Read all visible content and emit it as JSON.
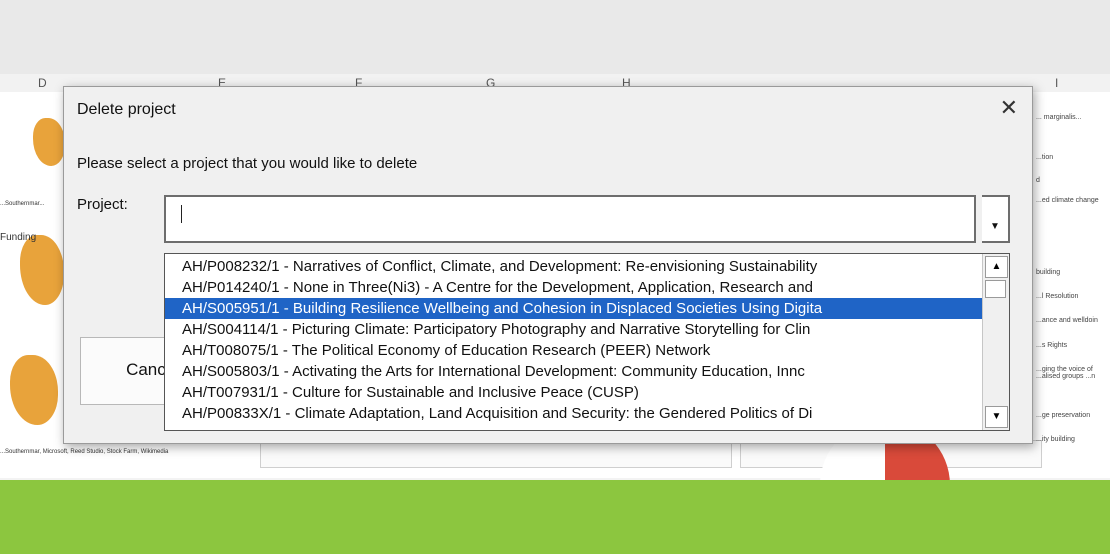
{
  "spreadsheet": {
    "columns": [
      "D",
      "E",
      "F",
      "G",
      "H",
      "I"
    ],
    "left_labels": [
      "Funding",
      "...Southernmar...",
      "...Southernmar, Microsoft, Reed Studio, Stock Farm, Wikimedia"
    ],
    "right_labels": [
      "... marginalis...",
      "...tion",
      "d",
      "...ed climate change",
      "building",
      "...l Resolution",
      "...ance and welldoin",
      "...s Rights",
      "...ging the voice of ...alised groups ...n",
      "...ge preservation",
      "...ity building"
    ]
  },
  "dialog": {
    "title": "Delete project",
    "prompt": "Please select a project that you would like to delete",
    "project_label": "Project:",
    "input_value": "",
    "cancel_label": "Cancel",
    "list_items": [
      "AH/P008232/1 - Narratives of Conflict, Climate, and Development: Re-envisioning Sustainability",
      "AH/P014240/1 - None in Three(Ni3) - A Centre for the Development, Application, Research and",
      "AH/S005951/1 - Building Resilience Wellbeing and Cohesion in Displaced Societies Using Digita",
      "AH/S004114/1 - Picturing Climate: Participatory Photography and Narrative Storytelling for Clin",
      "AH/T008075/1 - The Political Economy of Education Research (PEER) Network",
      "AH/S005803/1 - Activating the Arts for International Development: Community Education, Innc",
      "AH/T007931/1 - Culture for Sustainable and Inclusive Peace (CUSP)",
      "AH/P00833X/1 - Climate Adaptation, Land Acquisition and Security: the Gendered Politics of Di"
    ],
    "selected_index": 2
  },
  "icons": {
    "close": "close-icon",
    "dropdown": "chevron-down-icon",
    "scroll_up": "scroll-up-icon",
    "scroll_down": "scroll-down-icon"
  },
  "colors": {
    "selection": "#1f64c6",
    "green_bar": "#8cc63f"
  }
}
